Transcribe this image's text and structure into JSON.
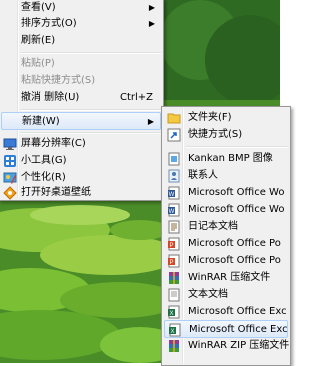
{
  "main_menu": {
    "items": [
      {
        "label": "查看(V)",
        "submenu": true
      },
      {
        "label": "排序方式(O)",
        "submenu": true
      },
      {
        "label": "刷新(E)"
      },
      {
        "label": "粘贴(P)",
        "disabled": true
      },
      {
        "label": "粘贴快捷方式(S)",
        "disabled": true
      },
      {
        "label": "撤消 删除(U)",
        "shortcut": "Ctrl+Z"
      },
      {
        "label": "新建(W)",
        "submenu": true
      },
      {
        "label": "屏幕分辨率(C)",
        "icon": "screen-resolution-icon"
      },
      {
        "label": "小工具(G)",
        "icon": "gadgets-icon"
      },
      {
        "label": "个性化(R)",
        "icon": "personalize-icon"
      },
      {
        "label": "打开好桌道壁纸",
        "icon": "wallpaper-icon"
      }
    ]
  },
  "new_submenu": {
    "items": [
      {
        "label": "文件夹(F)",
        "icon": "folder-icon"
      },
      {
        "label": "快捷方式(S)",
        "icon": "shortcut-icon"
      },
      {
        "label": "Kankan BMP 图像",
        "icon": "bmp-image-icon"
      },
      {
        "label": "联系人",
        "icon": "contact-icon"
      },
      {
        "label": "Microsoft Office Wo",
        "icon": "word-icon"
      },
      {
        "label": "Microsoft Office Wo",
        "icon": "word-icon"
      },
      {
        "label": "日记本文档",
        "icon": "journal-icon"
      },
      {
        "label": "Microsoft Office Po",
        "icon": "powerpoint-icon"
      },
      {
        "label": "Microsoft Office Po",
        "icon": "powerpoint-icon"
      },
      {
        "label": "WinRAR 压缩文件",
        "icon": "winrar-icon"
      },
      {
        "label": "文本文档",
        "icon": "text-document-icon"
      },
      {
        "label": "Microsoft Office Exc",
        "icon": "excel-icon"
      },
      {
        "label": "Microsoft Office Exc",
        "icon": "excel-icon"
      },
      {
        "label": "WinRAR ZIP 压缩文件",
        "icon": "winrar-zip-icon"
      }
    ]
  },
  "colors": {
    "menu_bg": "#f0f0f0",
    "highlight": "#dde9f9",
    "disabled_text": "#8d8d8d"
  },
  "arrow_glyph": "▶"
}
